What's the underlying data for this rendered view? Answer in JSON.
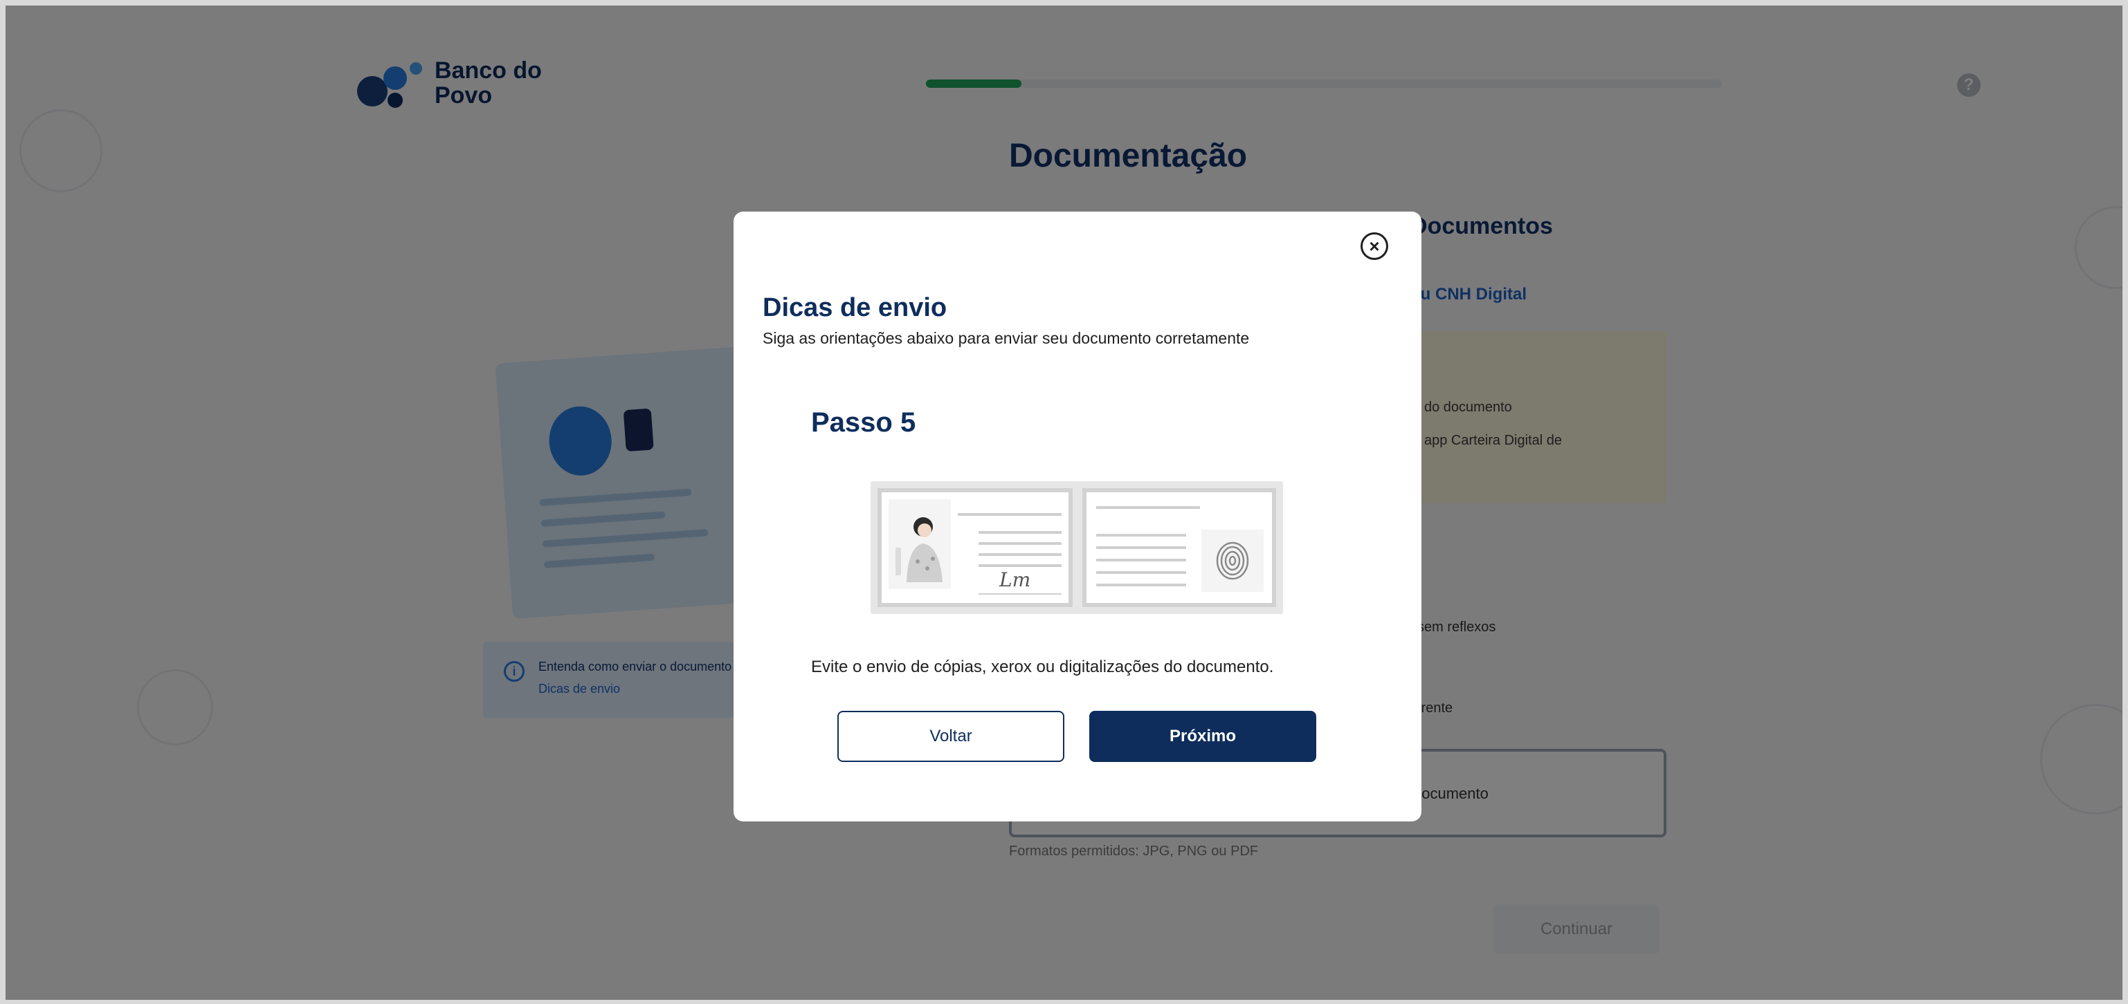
{
  "brand": {
    "logo_text": "Banco do Povo"
  },
  "header": {
    "progress_percent": 12
  },
  "page": {
    "title": "Documentação",
    "section_heading": "Documentos",
    "section_link": "ou CNH Digital",
    "warning_line_1": "do documento",
    "warning_line_2": "app Carteira Digital de",
    "hint_1": "sem reflexos",
    "hint_2": "frente",
    "upload_label": "documento",
    "upload_hint": "Formatos permitidos: JPG, PNG ou PDF",
    "continue_label": "Continuar",
    "info_text": "Entenda como enviar o documento",
    "info_link": "Dicas de envio"
  },
  "modal": {
    "title": "Dicas de envio",
    "subtitle": "Siga as orientações abaixo para enviar seu documento corretamente",
    "step_title": "Passo 5",
    "tip_text": "Evite o envio de cópias, xerox ou digitalizações do documento.",
    "signature_text": "Lm",
    "back_label": "Voltar",
    "next_label": "Próximo"
  },
  "colors": {
    "primary": "#0e2d5c",
    "progress": "#1fa45a",
    "overlay": "rgba(0,0,0,0.5)"
  }
}
